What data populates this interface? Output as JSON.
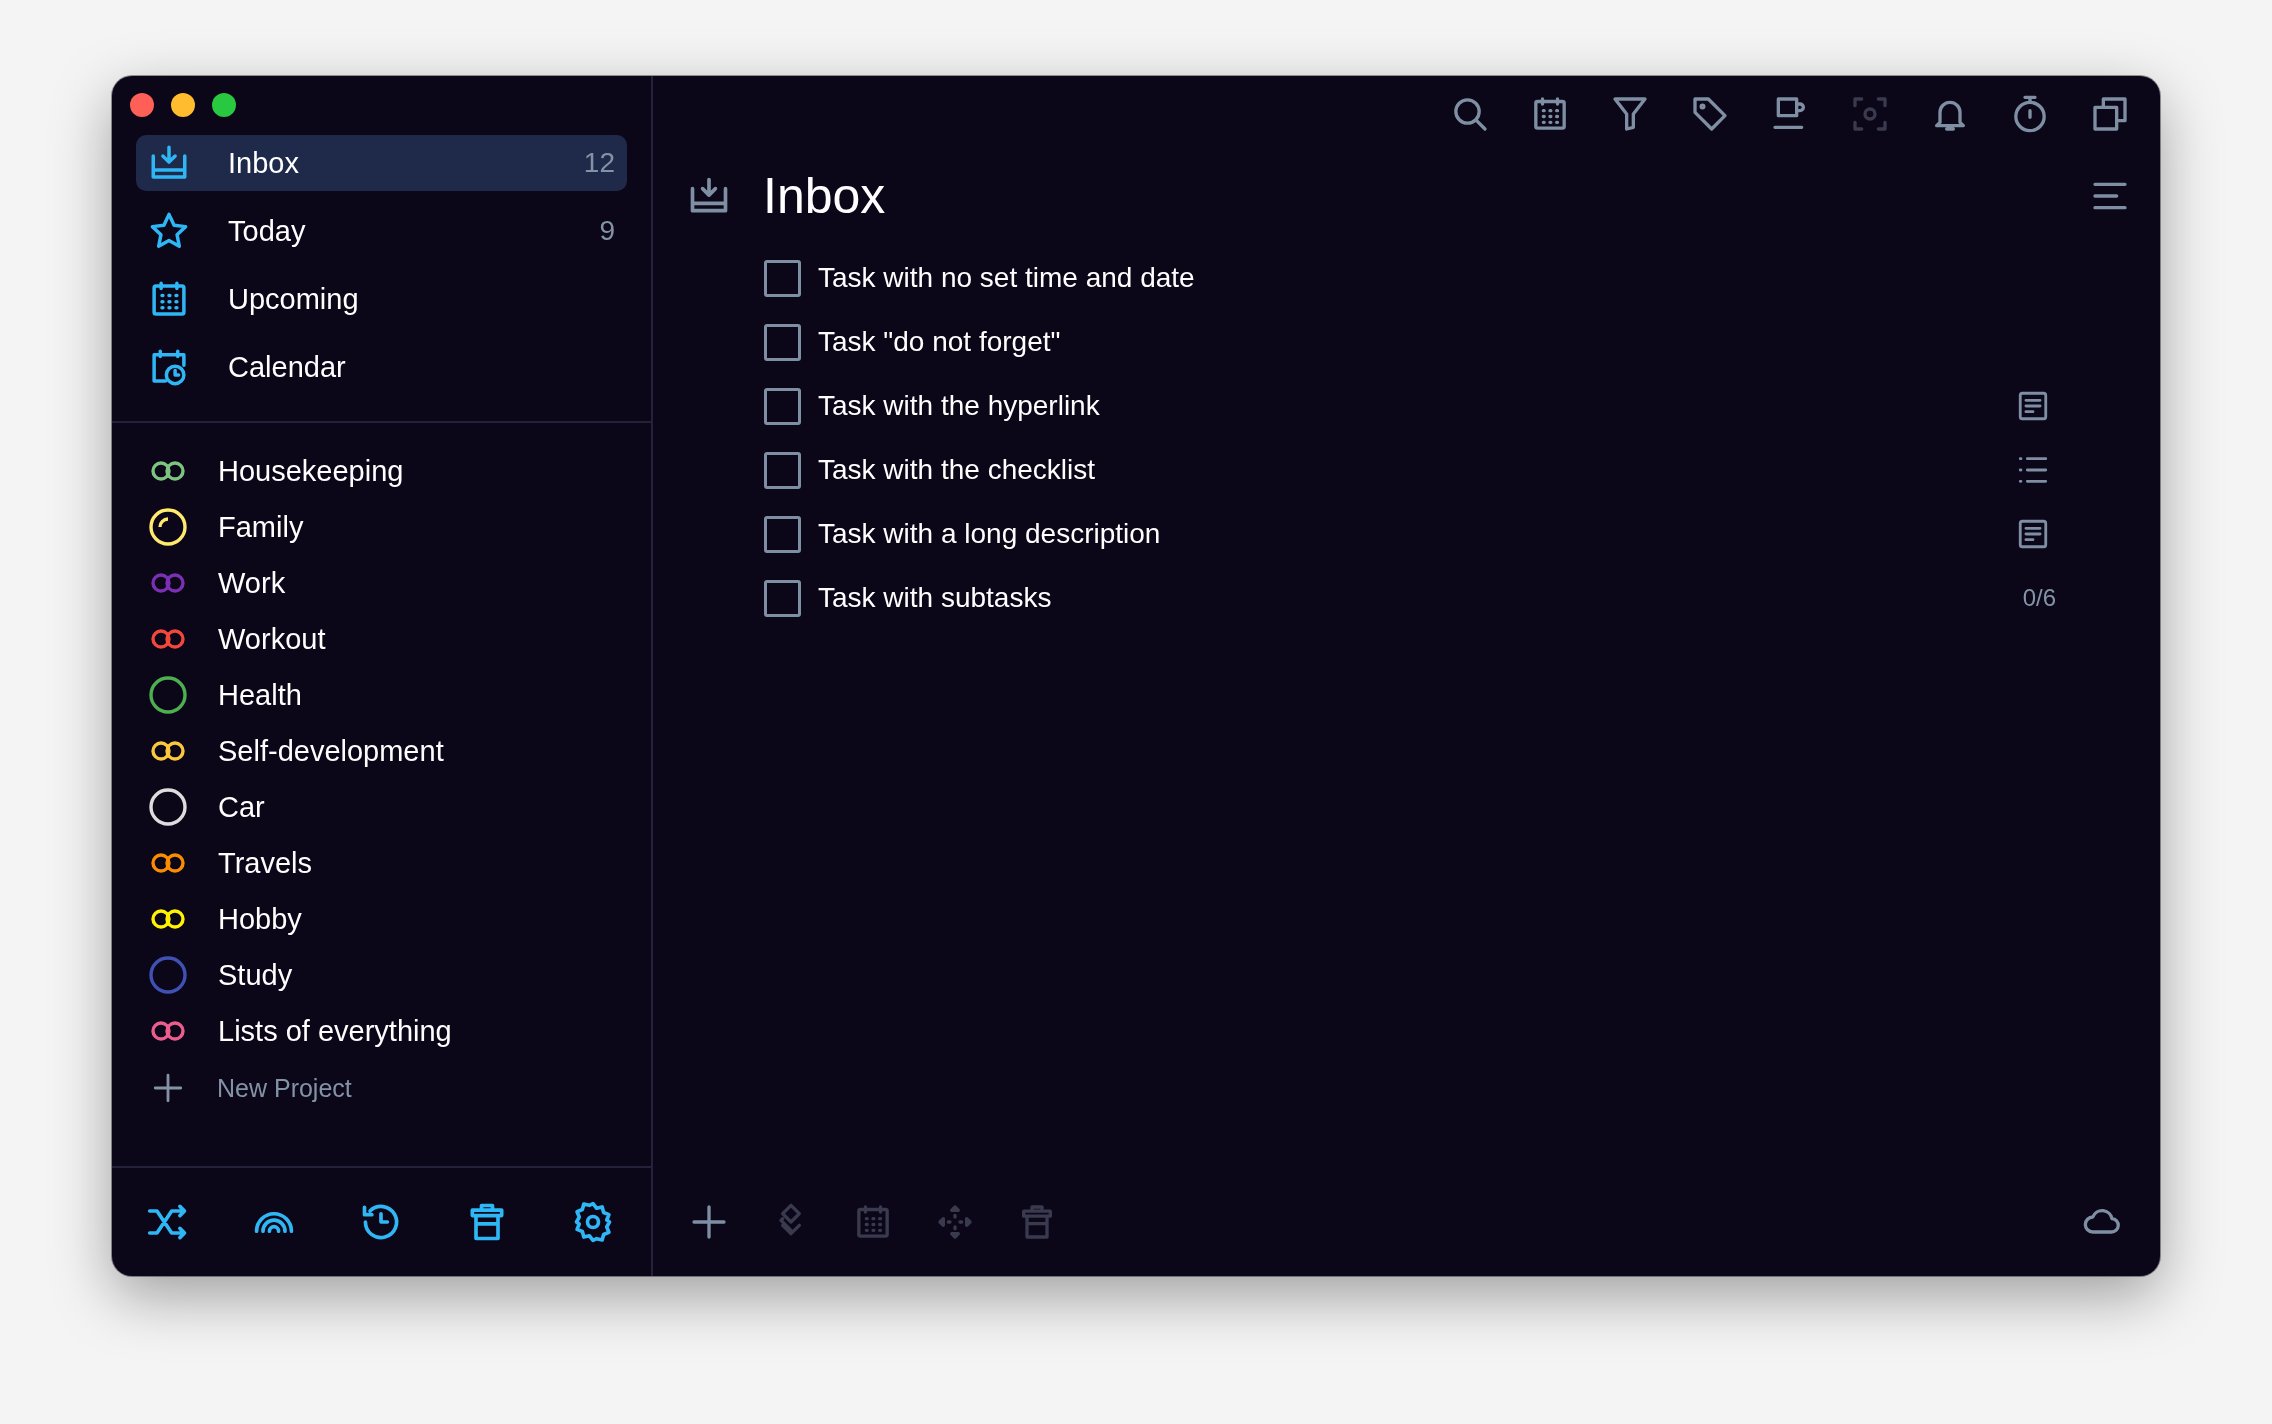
{
  "window": {
    "controls": [
      {
        "kind": "close"
      },
      {
        "kind": "minimize"
      },
      {
        "kind": "zoom"
      }
    ]
  },
  "sidebar": {
    "views": [
      {
        "kind": "inbox",
        "label": "Inbox",
        "count": "12",
        "selected": true
      },
      {
        "kind": "today",
        "label": "Today",
        "count": "9",
        "selected": false
      },
      {
        "kind": "upcoming",
        "label": "Upcoming",
        "selected": false
      },
      {
        "kind": "calendar",
        "label": "Calendar",
        "selected": false
      }
    ],
    "projects": [
      {
        "kind": "linked",
        "label": "Housekeeping",
        "color": "#7cc47f"
      },
      {
        "kind": "partial",
        "label": "Family",
        "color": "#fdea6e"
      },
      {
        "kind": "linked",
        "label": "Work",
        "color": "#7b2fb3"
      },
      {
        "kind": "linked",
        "label": "Workout",
        "color": "#f2473b"
      },
      {
        "kind": "ring",
        "label": "Health",
        "color": "#4caf50"
      },
      {
        "kind": "linked",
        "label": "Self-development",
        "color": "#fbc73c"
      },
      {
        "kind": "ring",
        "label": "Car",
        "color": "#dddddd"
      },
      {
        "kind": "linked",
        "label": "Travels",
        "color": "#fb8c00"
      },
      {
        "kind": "linked",
        "label": "Hobby",
        "color": "#fff200"
      },
      {
        "kind": "ring",
        "label": "Study",
        "color": "#3f51b5"
      },
      {
        "kind": "linked",
        "label": "Lists of everything",
        "color": "#ec5d8e"
      }
    ],
    "new_project": "New Project",
    "toolbar": [
      {
        "kind": "shuffle"
      },
      {
        "kind": "rainbow"
      },
      {
        "kind": "history"
      },
      {
        "kind": "trash"
      },
      {
        "kind": "settings"
      }
    ]
  },
  "main": {
    "toolbar": [
      {
        "kind": "search",
        "disabled": false
      },
      {
        "kind": "calendar",
        "disabled": false
      },
      {
        "kind": "filter",
        "disabled": false
      },
      {
        "kind": "tag",
        "disabled": false
      },
      {
        "kind": "cup",
        "disabled": false
      },
      {
        "kind": "focus",
        "disabled": true
      },
      {
        "kind": "bell",
        "disabled": false
      },
      {
        "kind": "timer",
        "disabled": false
      },
      {
        "kind": "copy",
        "disabled": false
      }
    ],
    "title": "Inbox",
    "tasks": [
      {
        "label": "Task with no set time and date",
        "checked": false
      },
      {
        "label": "Task \"do not forget\"",
        "checked": false
      },
      {
        "label": "Task with the hyperlink",
        "checked": false,
        "kind": "note"
      },
      {
        "label": "Task with the checklist",
        "checked": false,
        "kind": "list"
      },
      {
        "label": "Task with a long description",
        "checked": false,
        "kind": "note"
      },
      {
        "label": "Task with subtasks",
        "checked": false,
        "kind": "count",
        "count": "0/6"
      }
    ],
    "bottom_toolbar": [
      {
        "kind": "add",
        "disabled": false
      },
      {
        "kind": "priority",
        "disabled": true
      },
      {
        "kind": "calendar",
        "disabled": true
      },
      {
        "kind": "move",
        "disabled": true
      },
      {
        "kind": "trash",
        "disabled": true
      }
    ]
  }
}
